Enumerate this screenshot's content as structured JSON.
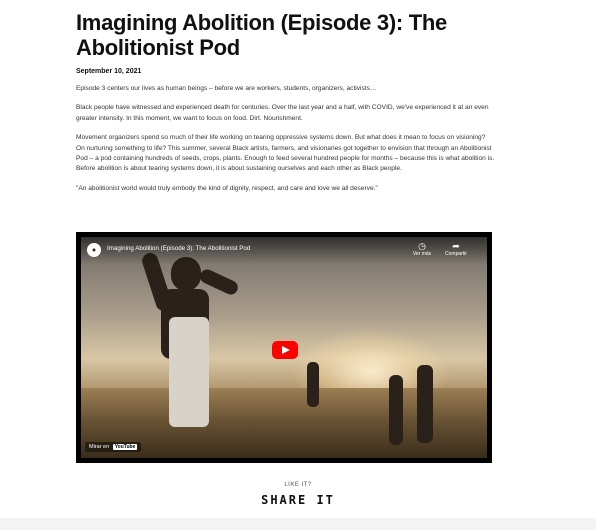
{
  "article": {
    "title": "Imagining Abolition (Episode 3): The Abolitionist Pod",
    "date": "September 10, 2021",
    "paragraphs": [
      "Episode 3 centers our lives as human beings – before we are workers, students, organizers, activists…",
      "Black people have witnessed and experienced death for centuries. Over the last year and a half, with COVID, we've experienced it at an even greater intensity. In this moment, we want to focus on food. Dirt. Nourishment.",
      "Movement organizers spend so much of their life working on tearing oppressive systems down. But what does it mean to focus on visioning? On nurturing something to life? This summer, several Black artists, farmers, and visionaries got together to envision that through an Abolitionist Pod – a pod containing hundreds of seeds, crops, plants. Enough to feed several hundred people for months – because this is what abolition is. Before abolition is about tearing systems down, it is about sustaining ourselves and each other as Black people.",
      "\"An abolitionist world would truly embody the kind of dignity, respect, and care and love we all deserve.\""
    ]
  },
  "video": {
    "title": "Imagining Abolition (Episode 3): The Abolitionist Pod",
    "watch_later": "Ver más",
    "share": "Compartir",
    "watch_on": "Mirar en",
    "youtube": "YouTube",
    "icons": [
      "clock-icon",
      "share-arrow-icon",
      "play-icon",
      "youtube-logo-icon"
    ],
    "play_color": "#ff0000"
  },
  "share": {
    "prompt": "LIKE IT?",
    "label": "SHARE IT"
  }
}
